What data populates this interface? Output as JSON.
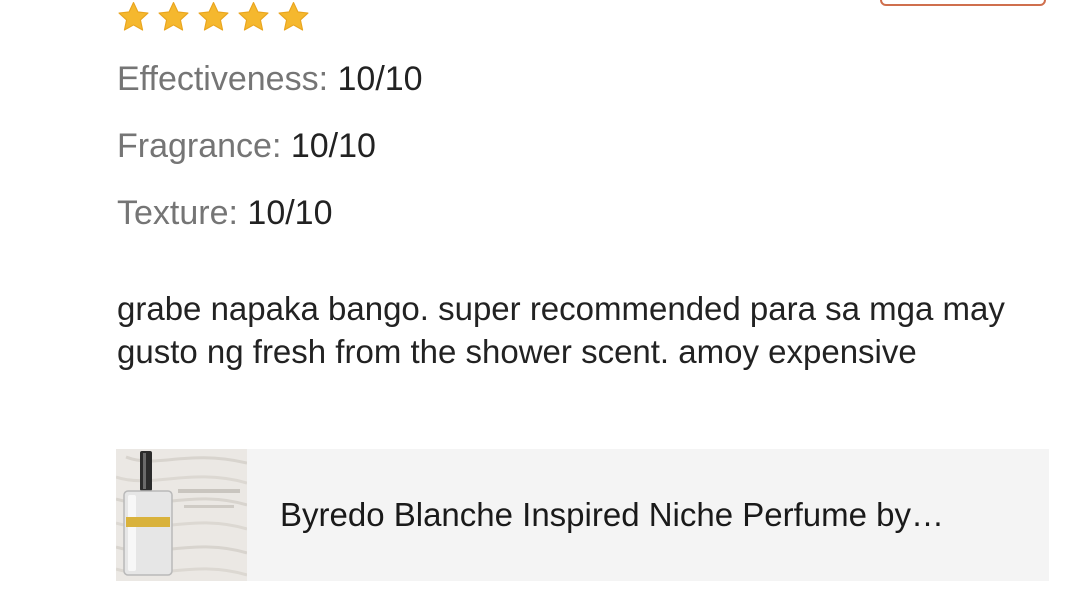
{
  "rating": {
    "stars": 5,
    "max_stars": 5,
    "star_color": "#f5b82e"
  },
  "attributes": [
    {
      "label": "Effectiveness:",
      "value": "10/10"
    },
    {
      "label": "Fragrance:",
      "value": "10/10"
    },
    {
      "label": "Texture:",
      "value": "10/10"
    }
  ],
  "review": {
    "text": "grabe napaka bango. super recommended para sa mga may gusto ng fresh from the shower scent. amoy expensive"
  },
  "product": {
    "title": "Byredo Blanche Inspired Niche Perfume by…",
    "thumbnail_icon": "perfume-bottle-image"
  },
  "colors": {
    "accent_border": "#cf6f4d",
    "card_background": "#f4f4f4"
  }
}
